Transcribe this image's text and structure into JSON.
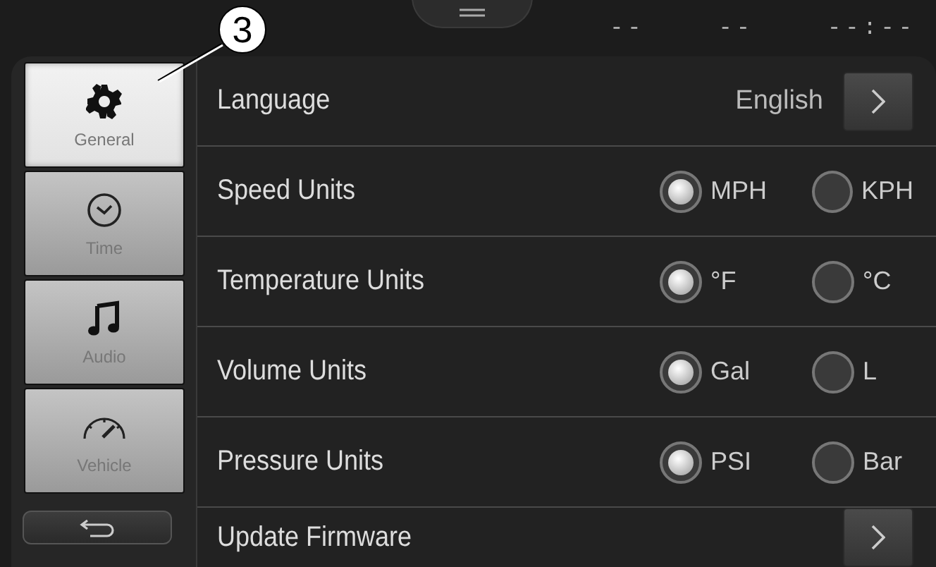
{
  "callout": "3",
  "status_bar": {
    "fields": [
      "--",
      "--",
      "--:--"
    ]
  },
  "sidebar": {
    "items": [
      {
        "label": "General",
        "selected": true
      },
      {
        "label": "Time",
        "selected": false
      },
      {
        "label": "Audio",
        "selected": false
      },
      {
        "label": "Vehicle",
        "selected": false
      }
    ]
  },
  "settings": [
    {
      "kind": "link",
      "label": "Language",
      "value": "English"
    },
    {
      "kind": "radio",
      "label": "Speed Units",
      "options": [
        {
          "label": "MPH",
          "selected": true
        },
        {
          "label": "KPH",
          "selected": false
        }
      ]
    },
    {
      "kind": "radio",
      "label": "Temperature Units",
      "options": [
        {
          "label": "°F",
          "selected": true
        },
        {
          "label": "°C",
          "selected": false
        }
      ]
    },
    {
      "kind": "radio",
      "label": "Volume Units",
      "options": [
        {
          "label": "Gal",
          "selected": true
        },
        {
          "label": "L",
          "selected": false
        }
      ]
    },
    {
      "kind": "radio",
      "label": "Pressure Units",
      "options": [
        {
          "label": "PSI",
          "selected": true
        },
        {
          "label": "Bar",
          "selected": false
        }
      ]
    },
    {
      "kind": "link",
      "label": "Update Firmware"
    }
  ]
}
